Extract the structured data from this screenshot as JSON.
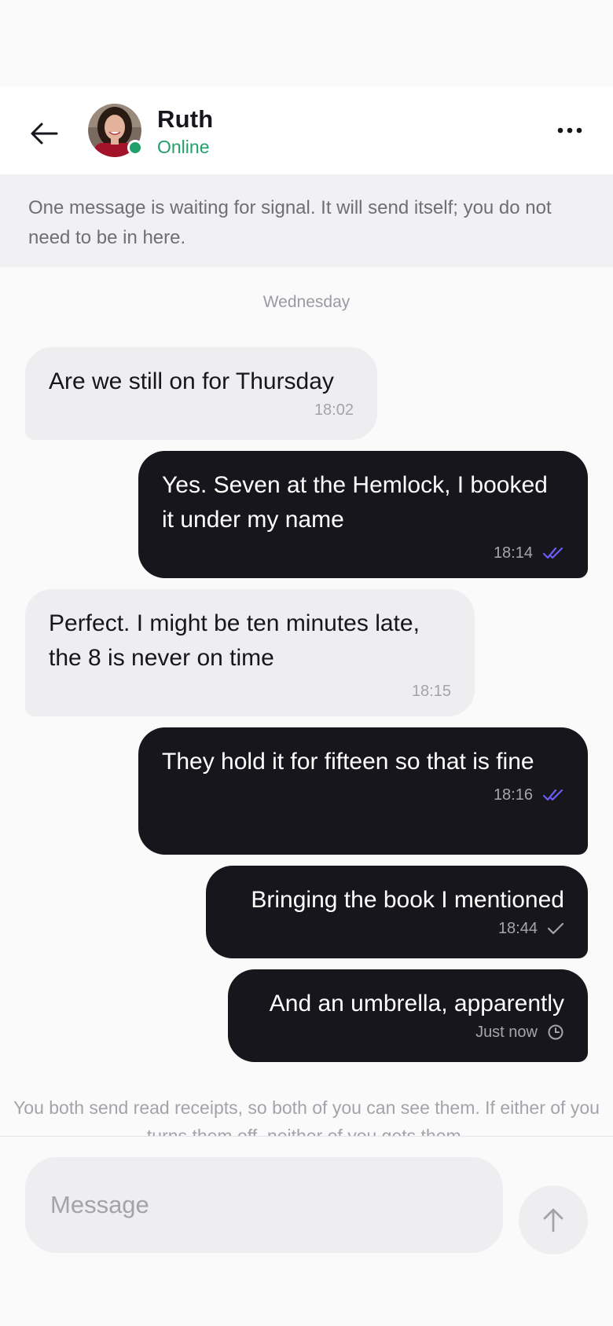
{
  "header": {
    "contact_name": "Ruth",
    "status": "Online",
    "status_color": "#22a06b"
  },
  "banner": {
    "text": "One message is waiting for signal. It will send itself; you do not need to be in here."
  },
  "day_label": "Wednesday",
  "messages": [
    {
      "direction": "in",
      "text": "Are we still on for Thursday",
      "time": "18:02",
      "status_icon": ""
    },
    {
      "direction": "out",
      "text": "Yes. Seven at the Hemlock, I booked it under my name",
      "time": "18:14",
      "status_icon": "double-check-read-icon"
    },
    {
      "direction": "in",
      "text": "Perfect. I might be ten minutes late, the 8 is never on time",
      "time": "18:15",
      "status_icon": ""
    },
    {
      "direction": "out",
      "text": "They hold it for fifteen so that is fine",
      "time": "18:16",
      "status_icon": "double-check-read-icon"
    },
    {
      "direction": "out",
      "text": "Bringing the book I mentioned",
      "time": "18:44",
      "status_icon": "single-check-icon"
    },
    {
      "direction": "out",
      "text": "And an umbrella, apparently",
      "time": "Just now",
      "status_icon": "clock-pending-icon"
    }
  ],
  "receipt_note": "You both send read receipts, so both of you can see them. If either of you turns them off, neither of you gets them.",
  "composer": {
    "placeholder": "Message"
  },
  "colors": {
    "read_receipt": "#6b5cf6",
    "incoming_bubble": "#eeeef1",
    "outgoing_bubble": "#17161c"
  }
}
